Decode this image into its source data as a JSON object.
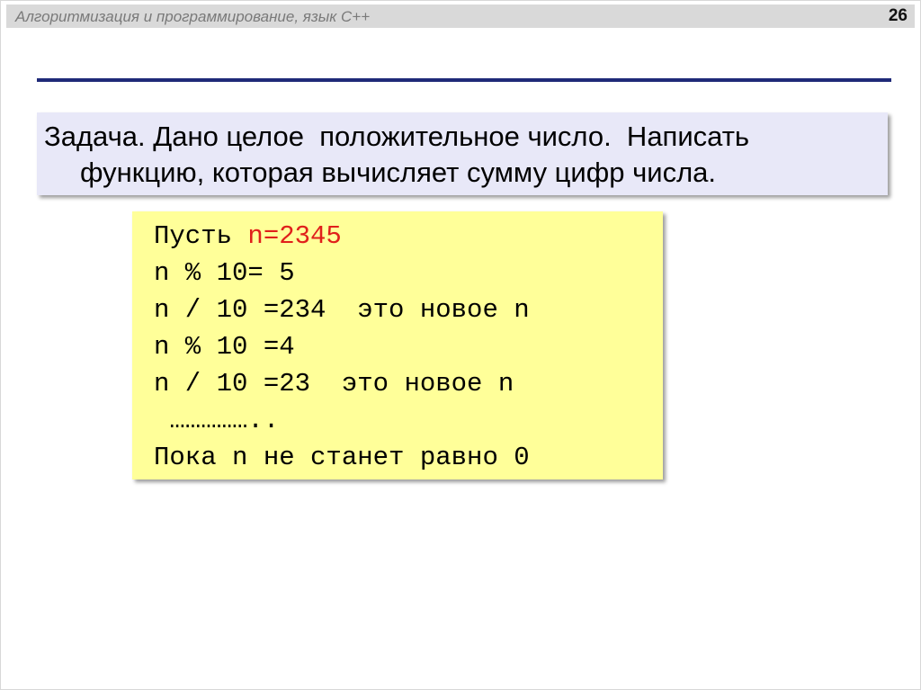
{
  "header": {
    "title": "Алгоритмизация и программирование, язык С++",
    "page_number": "26"
  },
  "task": {
    "line1": "Задача. Дано целое  положительное число.  Написать",
    "line2": "функцию, которая вычисляет сумму цифр числа."
  },
  "code": {
    "line1_prefix": "Пусть ",
    "line1_value": "n=2345",
    "line2": "n % 10= 5",
    "line3": "n / 10 =234  это новое n",
    "line4": "n % 10 =4",
    "line5": "n / 10 =23  это новое n",
    "line6": " ……………..",
    "line7": "Пока n не станет равно 0"
  },
  "colors": {
    "divider": "#1f2a78",
    "task_bg": "#e8e8f8",
    "code_bg": "#ffff99",
    "accent": "#e0201b"
  }
}
